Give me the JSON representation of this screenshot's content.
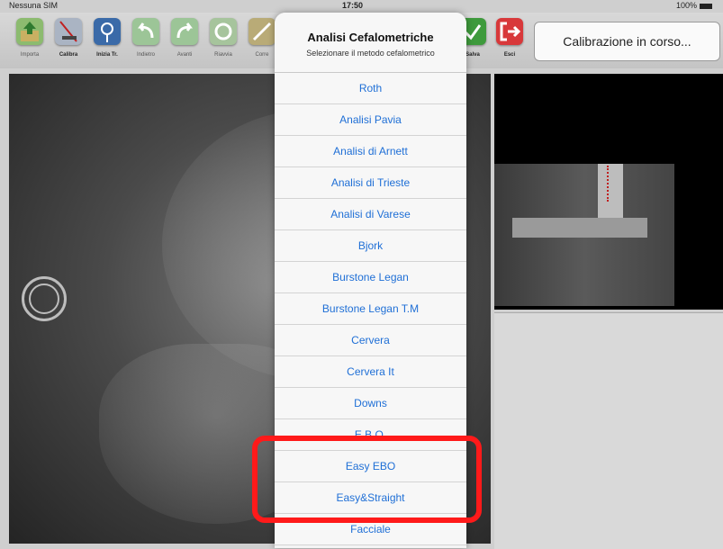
{
  "status_bar": {
    "carrier": "Nessuna SIM",
    "time": "17:50",
    "battery": "100%"
  },
  "toolbar": {
    "items": [
      {
        "label": "Importa",
        "icon": "import-icon",
        "color": "#7fb06a"
      },
      {
        "label": "Calibra",
        "icon": "calibrate-ruler-icon",
        "color": "#a9b4c6"
      },
      {
        "label": "Inizia Tr.",
        "icon": "start-tracing-icon",
        "color": "#3a6aa8"
      },
      {
        "label": "Indietro",
        "icon": "undo-arrow-icon",
        "color": "#8fc08a"
      },
      {
        "label": "Avanti",
        "icon": "redo-arrow-icon",
        "color": "#8fc08a"
      },
      {
        "label": "Riavvia",
        "icon": "restart-icon",
        "color": "#9fbf95"
      },
      {
        "label": "Corre",
        "icon": "correct-icon",
        "color": "#b7a873"
      },
      {
        "label": "Salva",
        "icon": "save-check-icon",
        "color": "#3e9a3c"
      },
      {
        "label": "Esci",
        "icon": "exit-icon",
        "color": "#d8383a"
      }
    ],
    "status_box": "Calibrazione in corso..."
  },
  "sheet": {
    "title": "Analisi Cefalometriche",
    "subtitle": "Selezionare il metodo cefalometrico",
    "options": [
      "Roth",
      "Analisi Pavia",
      "Analisi di Arnett",
      "Analisi di Trieste",
      "Analisi di Varese",
      "Bjork",
      "Burstone Legan",
      "Burstone Legan T.M",
      "Cervera",
      "Cervera It",
      "Downs",
      "E.B.O.",
      "Easy EBO",
      "Easy&Straight",
      "Facciale"
    ]
  },
  "colors": {
    "option_text": "#1f6fd6",
    "highlight": "#ff1a1a"
  }
}
